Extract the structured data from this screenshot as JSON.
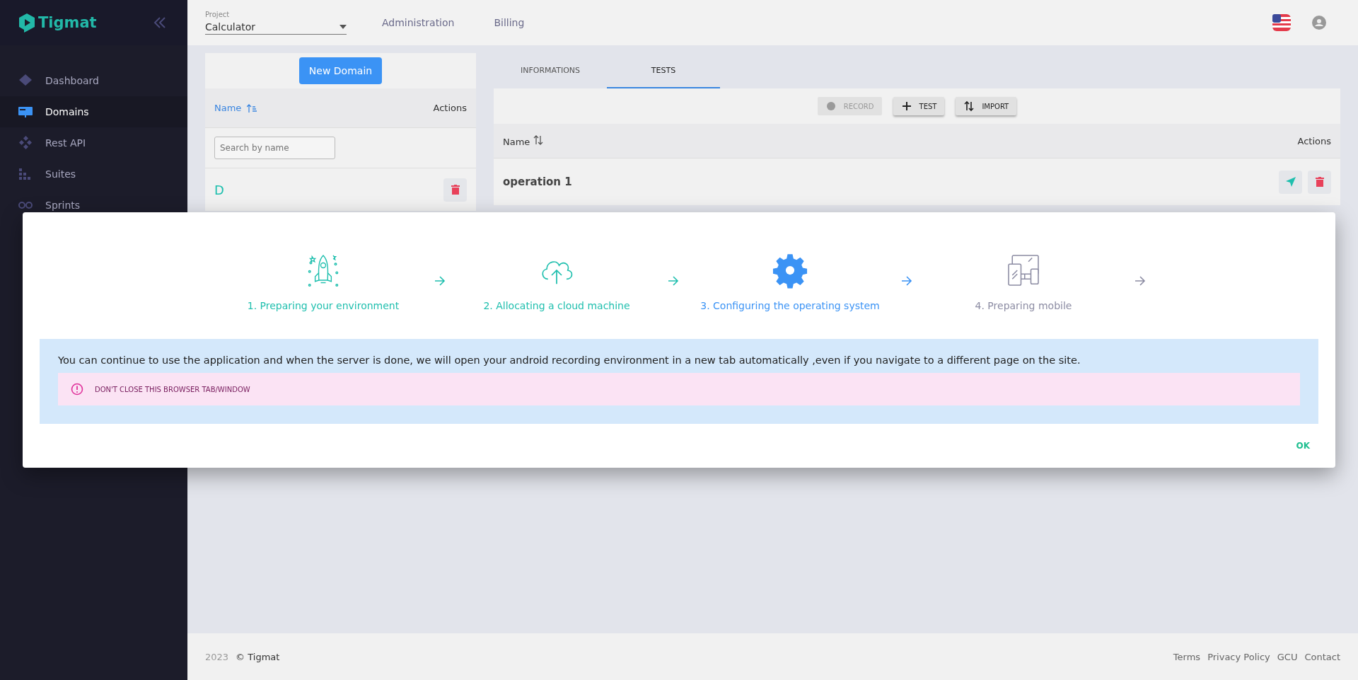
{
  "sidebar": {
    "brand": "Tigmat",
    "items": [
      {
        "label": "Dashboard",
        "selected": false
      },
      {
        "label": "Domains",
        "selected": true
      },
      {
        "label": "Rest API",
        "selected": false
      },
      {
        "label": "Suites",
        "selected": false
      },
      {
        "label": "Sprints",
        "selected": false
      }
    ]
  },
  "header": {
    "project": {
      "label": "Project",
      "value": "Calculator"
    },
    "nav": [
      "Administration",
      "Billing"
    ]
  },
  "domains": {
    "new_button": "New Domain",
    "columns": [
      "Name",
      "Actions"
    ],
    "search": {
      "placeholder": "Search by name"
    },
    "rows": [
      {
        "name": "D"
      }
    ]
  },
  "tabs": [
    {
      "label": "INFORMATIONS",
      "selected": false
    },
    {
      "label": "TESTS",
      "selected": true
    }
  ],
  "toolbar": [
    {
      "label": "RECORD",
      "disabled": true
    },
    {
      "label": "TEST",
      "disabled": false
    },
    {
      "label": "IMPORT",
      "disabled": false
    }
  ],
  "tests": {
    "columns": [
      "Name",
      "Actions"
    ],
    "rows": [
      {
        "name": "operation 1"
      }
    ]
  },
  "modal": {
    "steps": [
      {
        "label": "1. Preparing your environment",
        "color": "#1fbfae"
      },
      {
        "label": "2. Allocating a cloud machine",
        "color": "#1fbfae"
      },
      {
        "label": "3. Configuring the operating system",
        "color": "#3b93f5"
      },
      {
        "label": "4. Preparing mobile",
        "color": "#8c8ca3"
      }
    ],
    "message": "You can continue to use the application and when the server is done, we will open your android recording environment in a new tab automatically ,even if you navigate to a different page on the site.",
    "warning": "DON'T CLOSE THIS BROWSER TAB/WINDOW",
    "ok": "OK"
  },
  "footer": {
    "year": "2023",
    "copyright": "© Tigmat",
    "links": [
      "Terms",
      "Privacy Policy",
      "GCU",
      "Contact"
    ]
  }
}
